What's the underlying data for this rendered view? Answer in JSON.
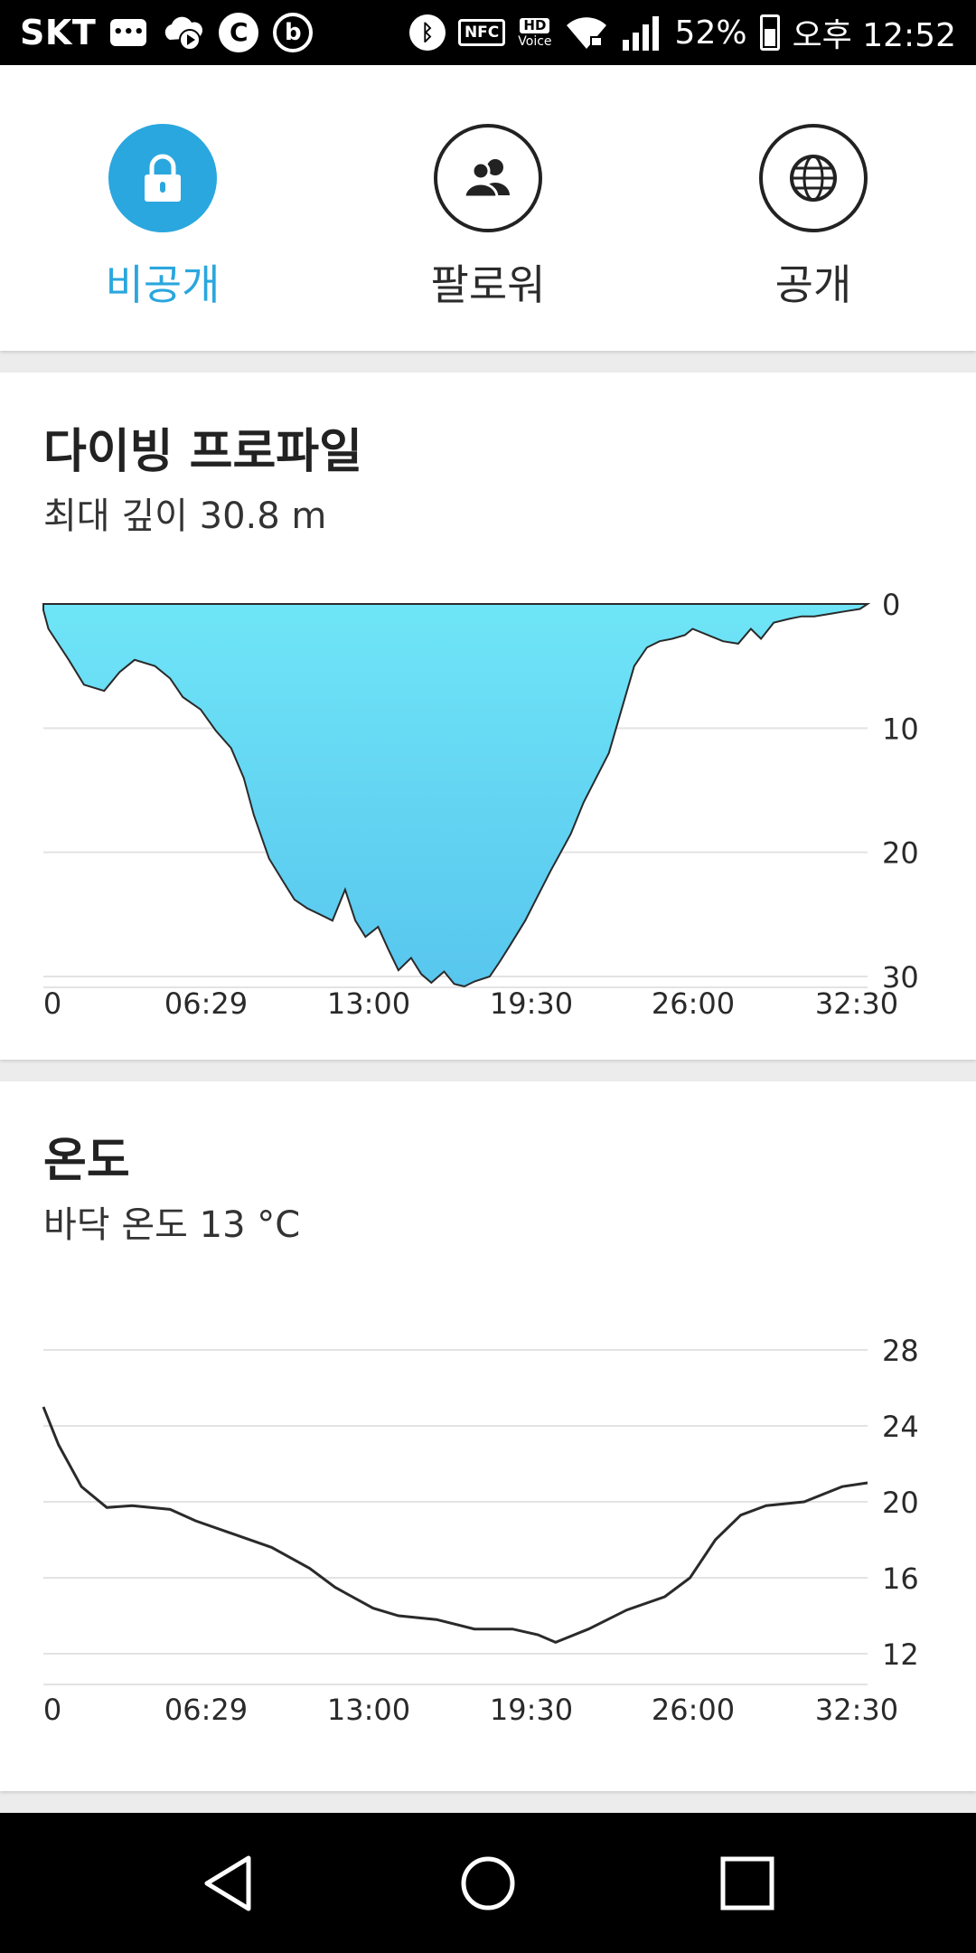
{
  "status_bar": {
    "carrier": "SKT",
    "battery": "52%",
    "time": "오후 12:52",
    "icons": [
      "message-icon",
      "cloud-play-icon",
      "c-circle-icon",
      "b-circle-icon",
      "bluetooth-icon",
      "nfc-icon",
      "hd-voice-icon",
      "wifi-icon",
      "signal-icon",
      "battery-icon"
    ],
    "nfc_label": "NFC",
    "hd_label": "HD",
    "voice_label": "Voice"
  },
  "privacy": {
    "selected": "private",
    "options": [
      {
        "id": "private",
        "label": "비공개",
        "icon": "lock-icon"
      },
      {
        "id": "followers",
        "label": "팔로워",
        "icon": "people-icon"
      },
      {
        "id": "public",
        "label": "공개",
        "icon": "globe-icon"
      }
    ]
  },
  "dive_profile": {
    "title": "다이빙 프로파일",
    "subtitle": "최대 깊이 30.8 m"
  },
  "temperature": {
    "title": "온도",
    "subtitle": "바닥 온도 13 °C"
  },
  "chart_data": [
    {
      "type": "area",
      "y_ticks": [
        "0",
        "10",
        "20",
        "30"
      ],
      "x_ticks": [
        "0",
        "06:29",
        "13:00",
        "19:30",
        "26:00",
        "32:30"
      ],
      "ylim": [
        0,
        30
      ],
      "inverted_y": true,
      "grid": true,
      "colors": {
        "fill_top": "#6fe5f7",
        "fill_bottom": "#58c6ee",
        "line": "#2a2a2a"
      },
      "x": [
        0,
        0.2,
        1,
        1.6,
        2.4,
        3.0,
        3.6,
        4.4,
        5.0,
        5.5,
        6.2,
        6.8,
        7.4,
        7.9,
        8.3,
        8.9,
        9.5,
        9.9,
        10.4,
        10.9,
        11.4,
        11.9,
        12.3,
        12.7,
        13.2,
        13.6,
        14.0,
        14.5,
        14.9,
        15.3,
        15.8,
        16.2,
        16.6,
        17.0,
        17.6,
        18.0,
        18.4,
        19.0,
        19.5,
        20.0,
        20.4,
        20.8,
        21.3,
        21.8,
        22.3,
        22.8,
        23.3,
        23.8,
        24.3,
        24.8,
        25.3,
        25.6,
        26.2,
        26.8,
        27.4,
        27.9,
        28.3,
        28.8,
        29.4,
        29.9,
        30.4,
        31.0,
        31.6,
        32.2,
        32.5
      ],
      "values": [
        0.5,
        2.0,
        4.5,
        6.5,
        7.0,
        5.5,
        4.5,
        5.0,
        6.0,
        7.5,
        8.5,
        10.2,
        11.6,
        14.0,
        17.0,
        20.5,
        22.5,
        23.8,
        24.5,
        25.0,
        25.5,
        23.0,
        25.5,
        26.8,
        26.0,
        27.8,
        29.5,
        28.5,
        29.8,
        30.5,
        29.6,
        30.6,
        30.8,
        30.4,
        30.0,
        28.8,
        27.5,
        25.5,
        23.5,
        21.5,
        20.0,
        18.5,
        16.0,
        14.0,
        12.0,
        8.5,
        5.0,
        3.5,
        3.0,
        2.8,
        2.5,
        2.0,
        2.5,
        3.0,
        3.2,
        2.0,
        2.8,
        1.5,
        1.2,
        1.0,
        1.0,
        0.8,
        0.6,
        0.4,
        0.0
      ]
    },
    {
      "type": "line",
      "y_ticks": [
        "28",
        "24",
        "20",
        "16",
        "12"
      ],
      "x_ticks": [
        "0",
        "06:29",
        "13:00",
        "19:30",
        "26:00",
        "32:30"
      ],
      "ylim": [
        11.5,
        28
      ],
      "grid": true,
      "colors": {
        "line": "#2a2a2a"
      },
      "x": [
        0,
        0.6,
        1.5,
        2.5,
        3.5,
        5.0,
        6.0,
        7.5,
        9.0,
        10.5,
        11.5,
        13.0,
        14.0,
        15.5,
        17.0,
        18.5,
        19.5,
        20.2,
        21.5,
        23.0,
        24.5,
        25.5,
        26.5,
        27.5,
        28.5,
        30.0,
        31.5,
        32.5
      ],
      "values": [
        25.0,
        23.0,
        20.8,
        19.7,
        19.8,
        19.6,
        19.0,
        18.3,
        17.6,
        16.5,
        15.5,
        14.4,
        14.0,
        13.8,
        13.3,
        13.3,
        13.0,
        12.6,
        13.3,
        14.3,
        15.0,
        16.0,
        18.0,
        19.3,
        19.8,
        20.0,
        20.8,
        21.0
      ]
    }
  ],
  "nav_bar": {
    "icons": [
      "back-icon",
      "home-icon",
      "recents-icon"
    ]
  }
}
